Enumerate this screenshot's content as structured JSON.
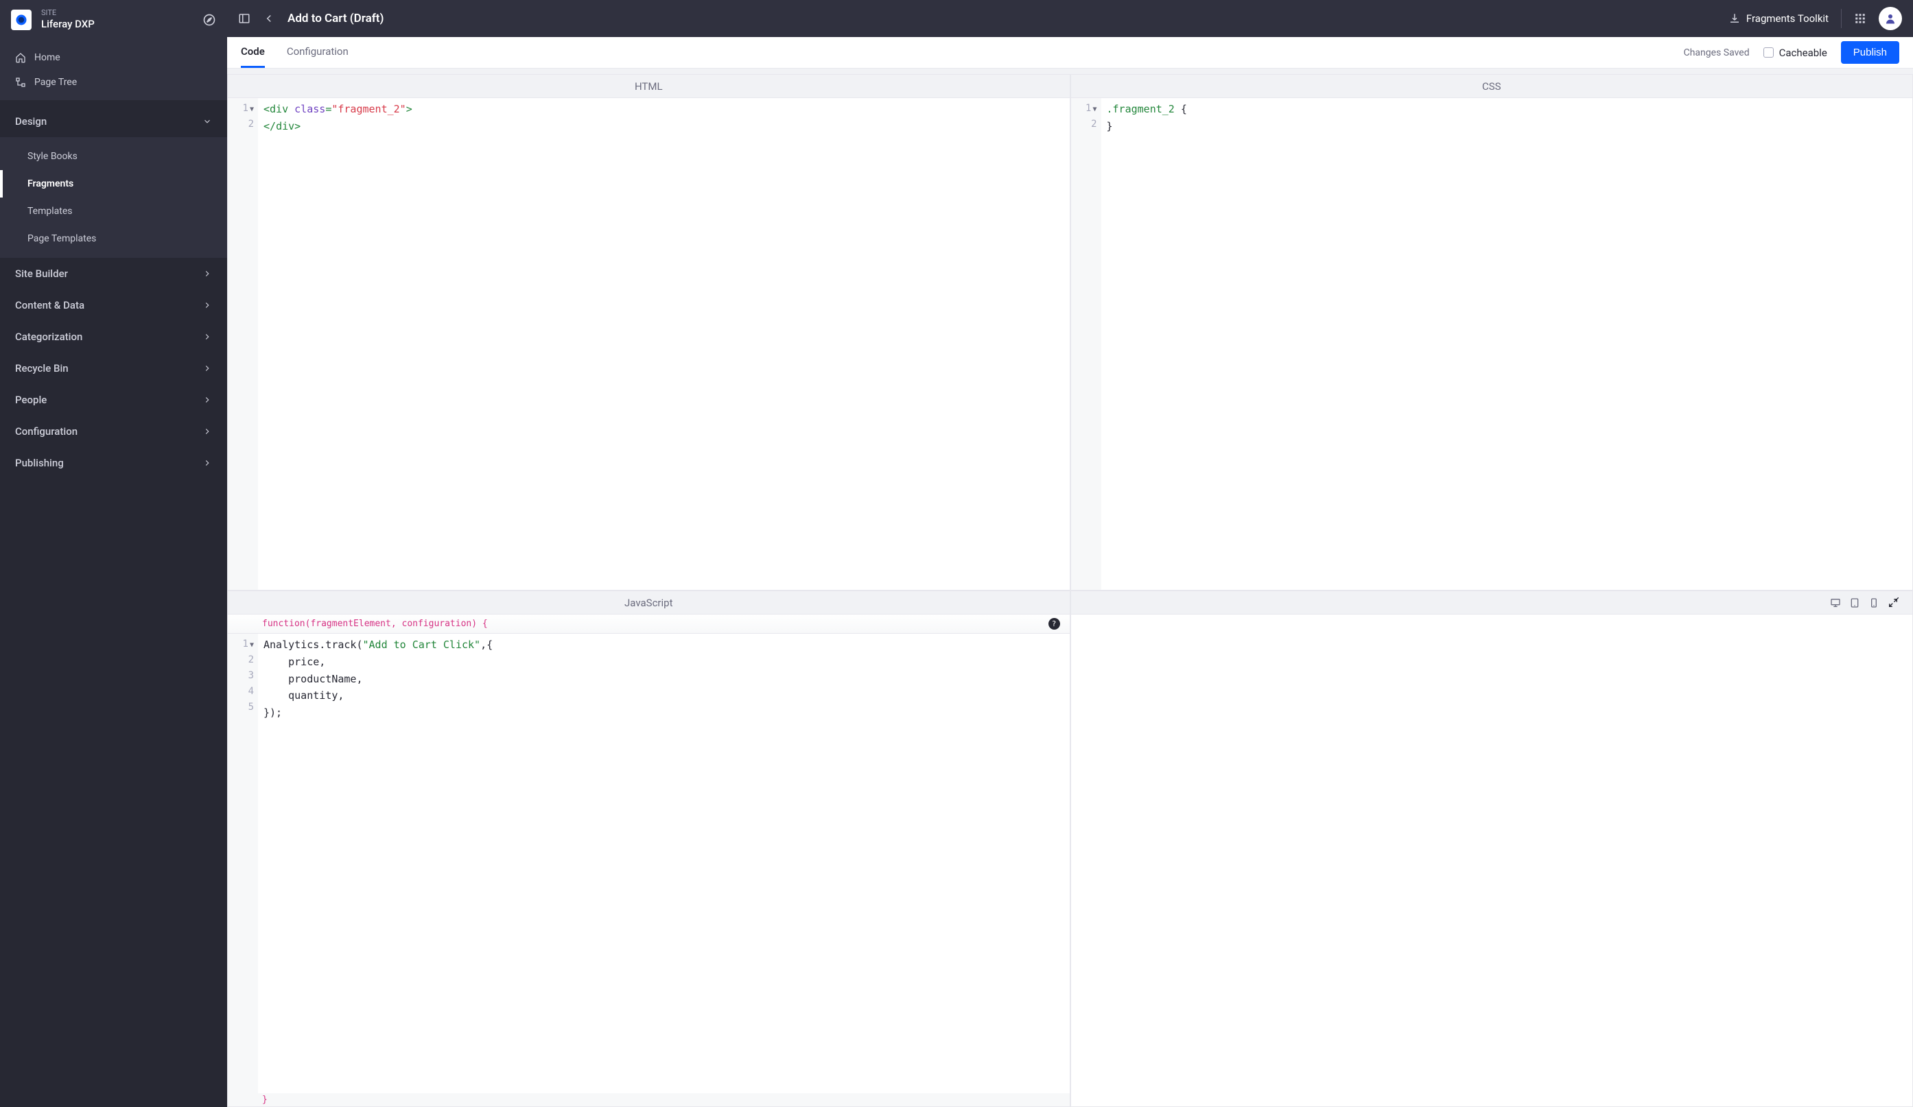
{
  "site": {
    "label": "SITE",
    "name": "Liferay DXP"
  },
  "nav_top": {
    "home": "Home",
    "page_tree": "Page Tree"
  },
  "nav": {
    "design": {
      "label": "Design",
      "items": [
        "Style Books",
        "Fragments",
        "Templates",
        "Page Templates"
      ],
      "active_index": 1
    },
    "others": [
      "Site Builder",
      "Content & Data",
      "Categorization",
      "Recycle Bin",
      "People",
      "Configuration",
      "Publishing"
    ]
  },
  "topbar": {
    "title": "Add to Cart (Draft)",
    "toolkit": "Fragments Toolkit"
  },
  "tabs": {
    "code": "Code",
    "config": "Configuration",
    "saved": "Changes Saved",
    "cacheable": "Cacheable",
    "publish": "Publish"
  },
  "panes": {
    "html": "HTML",
    "css": "CSS",
    "js": "JavaScript"
  },
  "code": {
    "html_lines": {
      "l1_open": "<",
      "l1_tag": "div",
      "l1_attr": " class",
      "l1_eq": "=",
      "l1_val": "\"fragment_2\"",
      "l1_close": ">",
      "l2_open": "</",
      "l2_tag": "div",
      "l2_close": ">"
    },
    "css_lines": {
      "sel": ".fragment_2",
      "open": " {",
      "close": "}"
    },
    "js_banner": "function(fragmentElement, configuration) {",
    "js_footer": "}",
    "js_lines": {
      "l1a": "Analytics.track(",
      "l1b": "\"Add to Cart Click\"",
      "l1c": ",{",
      "l2": "    price,",
      "l3": "    productName,",
      "l4": "    quantity,",
      "l5": "});"
    }
  },
  "gutter": {
    "n1": "1",
    "n2": "2",
    "n3": "3",
    "n4": "4",
    "n5": "5"
  }
}
